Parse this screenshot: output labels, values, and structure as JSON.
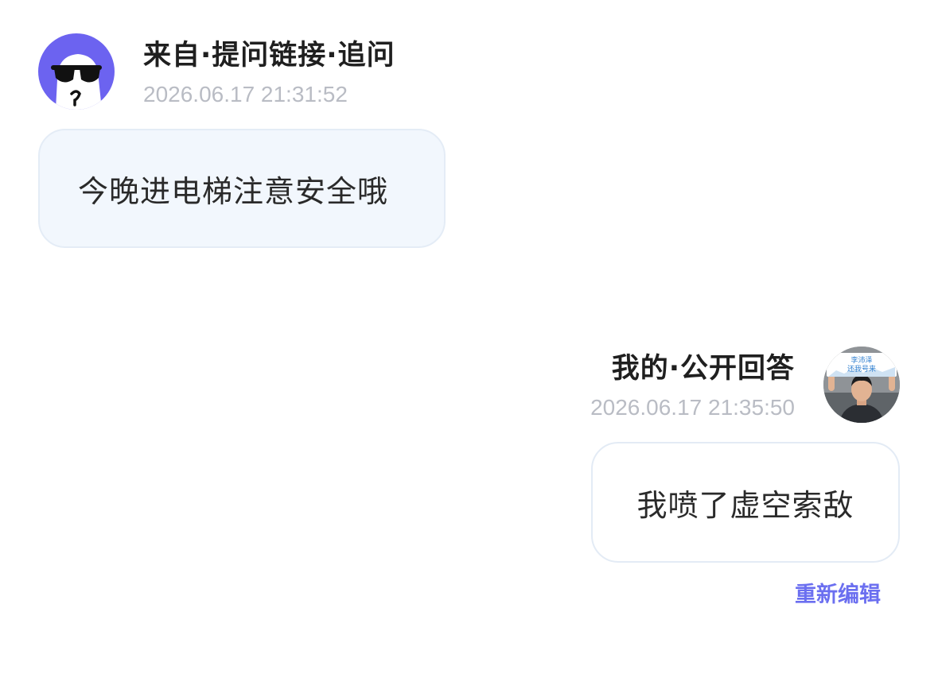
{
  "incoming": {
    "sender": "来自·提问链接·追问",
    "timestamp": "2026.06.17 21:31:52",
    "message": "今晚进电梯注意安全哦",
    "avatar_icon": "sunglasses-ghost-avatar",
    "avatar_color": "#6c63f0"
  },
  "outgoing": {
    "sender": "我的·公开回答",
    "timestamp": "2026.06.17 21:35:50",
    "message": "我喷了虚空索敌",
    "avatar_sign_line1": "李沛泽",
    "avatar_sign_line2": "还我号来"
  },
  "actions": {
    "re_edit_label": "重新编辑"
  },
  "colors": {
    "accent": "#6b6ff0",
    "incoming_bubble": "#f2f7fd",
    "timestamp": "#b9bcc4"
  }
}
